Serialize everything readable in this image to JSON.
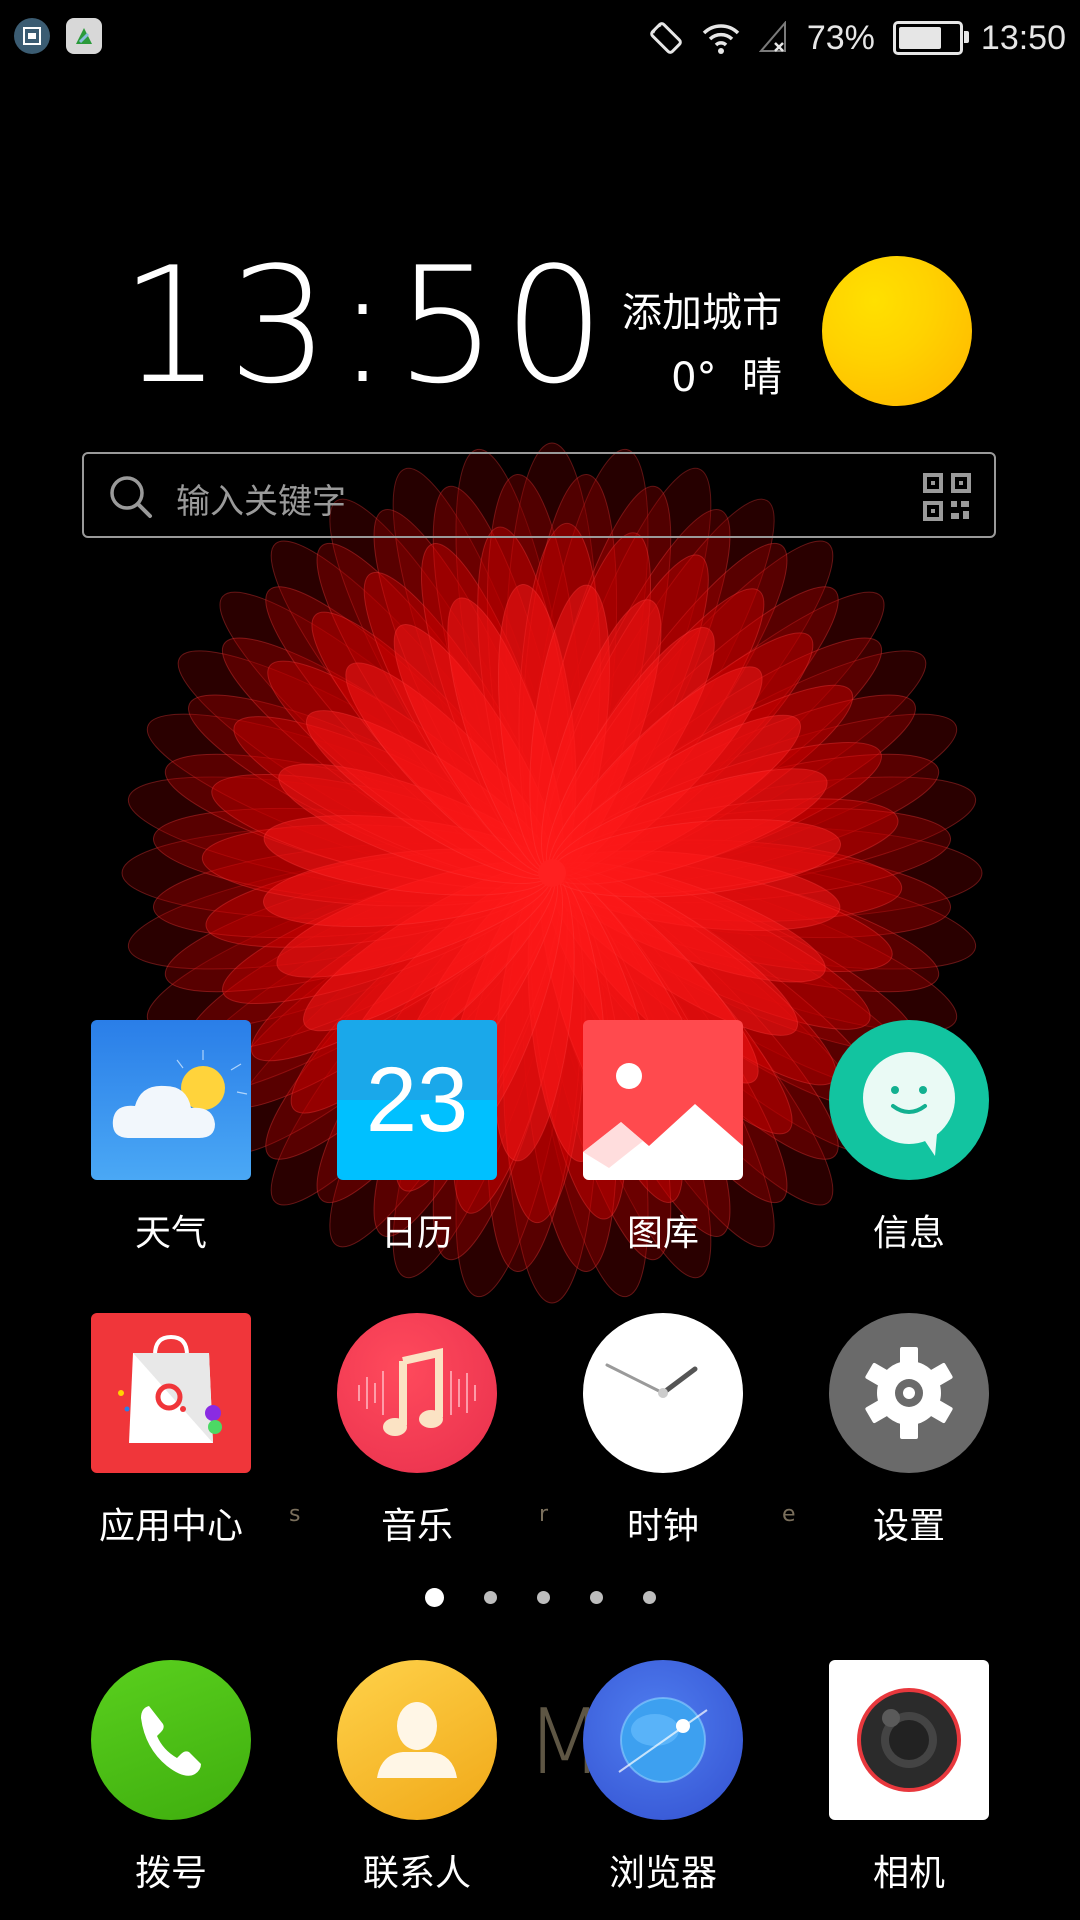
{
  "status_bar": {
    "battery_percent_label": "73%",
    "battery_level": 0.73,
    "time": "13:50",
    "icons": [
      "screenshot-notification-icon",
      "app-notification-icon",
      "rotation-lock-icon",
      "wifi-icon",
      "no-signal-icon",
      "battery-icon"
    ]
  },
  "clock_widget": {
    "time": "13:50",
    "city": "添加城市",
    "temperature": "0°",
    "condition": "晴",
    "colors": {
      "sun": "#ffc800"
    }
  },
  "search": {
    "placeholder": "输入关键字",
    "icons": [
      "search-icon",
      "qr-code-icon"
    ]
  },
  "apps": [
    {
      "label": "天气",
      "icon": "weather-icon"
    },
    {
      "label": "日历",
      "icon": "calendar-icon",
      "calendar_day": "23"
    },
    {
      "label": "图库",
      "icon": "gallery-icon"
    },
    {
      "label": "信息",
      "icon": "messages-icon"
    },
    {
      "label": "应用中心",
      "icon": "app-store-icon"
    },
    {
      "label": "音乐",
      "icon": "music-icon"
    },
    {
      "label": "时钟",
      "icon": "clock-icon"
    },
    {
      "label": "设置",
      "icon": "settings-icon"
    }
  ],
  "page_indicator": {
    "pages": 5,
    "current": 1
  },
  "dock": [
    {
      "label": "拨号",
      "icon": "phone-icon"
    },
    {
      "label": "联系人",
      "icon": "contacts-icon"
    },
    {
      "label": "浏览器",
      "icon": "browser-icon"
    },
    {
      "label": "相机",
      "icon": "camera-icon"
    }
  ],
  "wallpaper_faint_text": {
    "s": "s",
    "r": "r",
    "e": "e",
    "m": "M"
  },
  "colors": {
    "wallpaper_flower": "#e00000",
    "weather_bg": "#1e88e5",
    "calendar_bg": "#00b8f0",
    "gallery_bg": "#ff4a4e",
    "messages_bg": "#12c4a0",
    "app_store_bg": "#f0363a",
    "music_bg": "#ee3a55",
    "settings_bg": "#6a6a6a",
    "phone_bg": "#4cc413",
    "contacts_bg": "#f5b41c",
    "browser_bg": "#3f64e0"
  }
}
